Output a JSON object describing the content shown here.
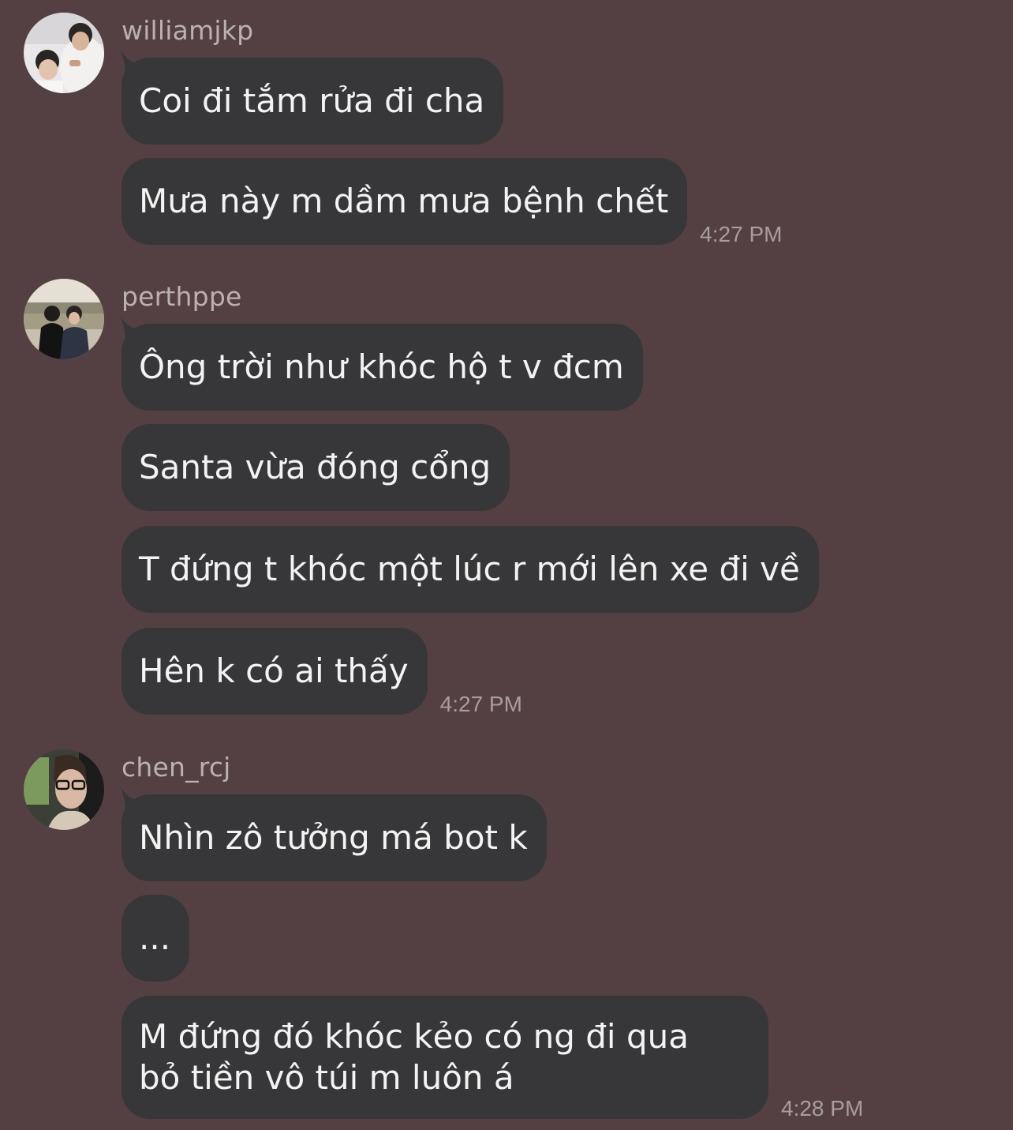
{
  "messages": [
    {
      "username": "williamjkp",
      "bubbles": [
        {
          "text": "Coi đi tắm rửa đi cha"
        },
        {
          "text": "Mưa này m dầm mưa bệnh chết",
          "time": "4:27 PM"
        }
      ]
    },
    {
      "username": "perthppe",
      "bubbles": [
        {
          "text": "Ông trời như khóc hộ t v đcm"
        },
        {
          "text": "Santa vừa đóng cổng"
        },
        {
          "text": "T đứng t khóc một lúc r mới lên xe đi về"
        },
        {
          "text": "Hên k có ai thấy",
          "time": "4:27 PM"
        }
      ]
    },
    {
      "username": "chen_rcj",
      "bubbles": [
        {
          "text": "Nhìn zô tưởng má bot k"
        },
        {
          "text": "..."
        },
        {
          "text": "M đứng đó khóc kẻo có ng đi qua bỏ tiền vô túi m luôn á",
          "time": "4:28 PM"
        }
      ]
    }
  ],
  "colors": {
    "background": "#544042",
    "bubble": "#373638",
    "bubble_text": "#f4f3f4",
    "username": "#bcb0b1",
    "timestamp": "#a99d9f"
  },
  "avatars": [
    "avatar-williamjkp",
    "avatar-perthppe",
    "avatar-chen_rcj"
  ]
}
